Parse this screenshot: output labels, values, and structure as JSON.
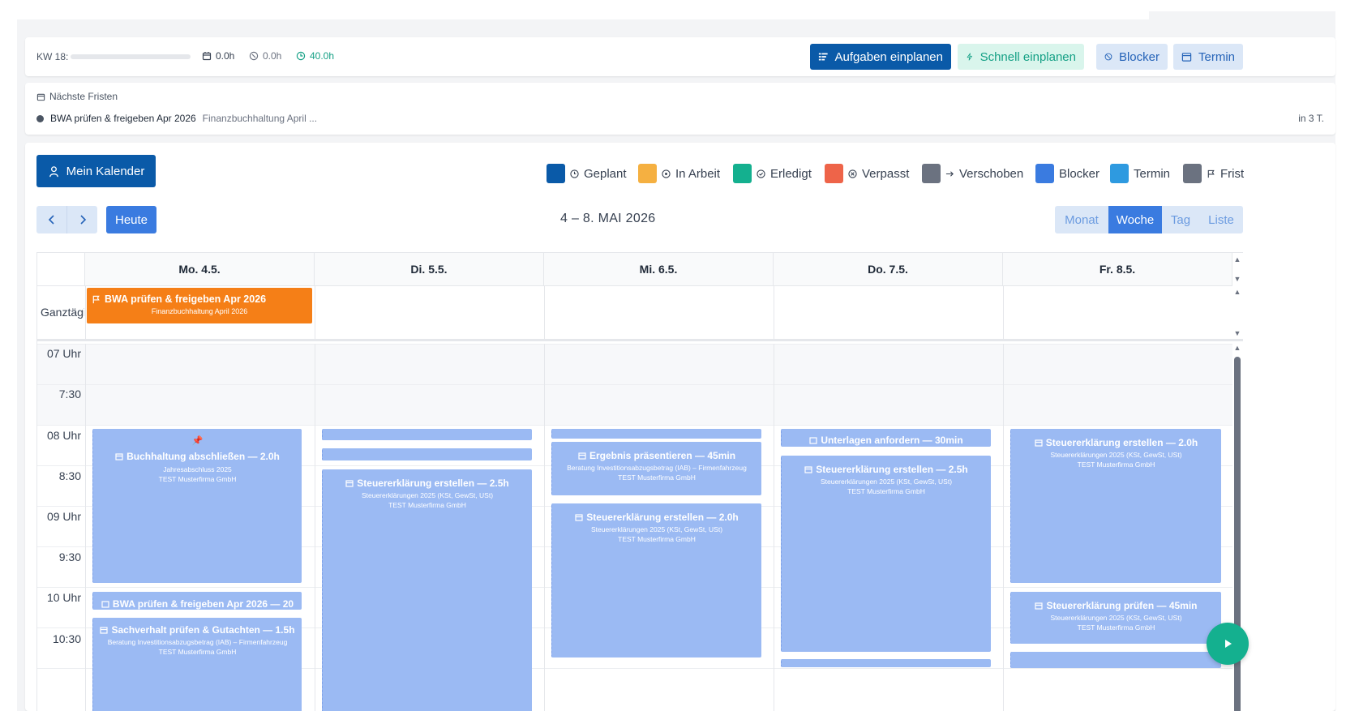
{
  "stats_bar": {
    "week_label": "KW 18:",
    "planned_hours": "0.0h",
    "in_progress_hours": "0.0h",
    "capacity_hours": "40.0h",
    "colors": {
      "capacity": "#14a085"
    }
  },
  "actions": {
    "plan_tasks": "Aufgaben einplanen",
    "quick_plan": "Schnell einplanen",
    "blocker": "Blocker",
    "appointment": "Termin"
  },
  "deadlines": {
    "title": "Nächste Fristen",
    "items": [
      {
        "title": "BWA prüfen & freigeben Apr 2026",
        "subtitle": "Finanzbuchhaltung April ...",
        "due": "in 3 T."
      }
    ]
  },
  "calendar": {
    "my_calendar_label": "Mein Kalender",
    "legend": [
      {
        "label": "Geplant",
        "color": "#0a5aa8",
        "icon": "clock-icon"
      },
      {
        "label": "In Arbeit",
        "color": "#f5b041",
        "icon": "play-circle-icon"
      },
      {
        "label": "Erledigt",
        "color": "#14b08f",
        "icon": "check-circle-icon"
      },
      {
        "label": "Verpasst",
        "color": "#ee6449",
        "icon": "x-circle-icon"
      },
      {
        "label": "Verschoben",
        "color": "#6b7280",
        "icon": "arrow-right-icon"
      },
      {
        "label": "Blocker",
        "color": "#3a7be0",
        "icon": ""
      },
      {
        "label": "Termin",
        "color": "#2e9ae0",
        "icon": ""
      },
      {
        "label": "Frist",
        "color": "#6b7280",
        "icon": "flag-icon"
      }
    ],
    "today_label": "Heute",
    "date_range": "4 – 8. MAI 2026",
    "views": [
      "Monat",
      "Woche",
      "Tag",
      "Liste"
    ],
    "active_view": "Woche",
    "days": [
      "Mo. 4.5.",
      "Di. 5.5.",
      "Mi. 6.5.",
      "Do. 7.5.",
      "Fr. 8.5."
    ],
    "all_day_label": "Ganztägig",
    "all_day_event": {
      "title": "BWA prüfen & freigeben Apr 2026",
      "subtitle": "Finanzbuchhaltung April 2026",
      "color": "#f57f17"
    },
    "time_labels": [
      "07 Uhr",
      "7:30",
      "08 Uhr",
      "8:30",
      "09 Uhr",
      "9:30",
      "10 Uhr",
      "10:30"
    ],
    "events": {
      "mon_1": {
        "title": "Buchhaltung abschließen — 2.0h",
        "line1": "Jahresabschluss 2025",
        "line2": "TEST Musterfirma GmbH"
      },
      "mon_2": {
        "title": "BWA prüfen & freigeben Apr 2026 — 20"
      },
      "mon_3": {
        "title": "Sachverhalt prüfen & Gutachten — 1.5h",
        "line1": "Beratung Investitionsabzugsbetrag (IAB) – Firmenfahrzeug",
        "line2": "TEST Musterfirma GmbH"
      },
      "tue_1": {
        "title": "Steuererklärung erstellen — 2.5h",
        "line1": "Steuererklärungen 2025 (KSt, GewSt, USt)",
        "line2": "TEST Musterfirma GmbH"
      },
      "wed_1": {
        "title": "Ergebnis präsentieren — 45min",
        "line1": "Beratung Investitionsabzugsbetrag (IAB) – Firmenfahrzeug",
        "line2": "TEST Musterfirma GmbH"
      },
      "wed_2": {
        "title": "Steuererklärung erstellen — 2.0h",
        "line1": "Steuererklärungen 2025 (KSt, GewSt, USt)",
        "line2": "TEST Musterfirma GmbH"
      },
      "thu_1": {
        "title": "Unterlagen anfordern — 30min"
      },
      "thu_2": {
        "title": "Steuererklärung erstellen — 2.5h",
        "line1": "Steuererklärungen 2025 (KSt, GewSt, USt)",
        "line2": "TEST Musterfirma GmbH"
      },
      "fri_1": {
        "title": "Steuererklärung erstellen — 2.0h",
        "line1": "Steuererklärungen 2025 (KSt, GewSt, USt)",
        "line2": "TEST Musterfirma GmbH"
      },
      "fri_2": {
        "title": "Steuererklärung prüfen — 45min",
        "line1": "Steuererklärungen 2025 (KSt, GewSt, USt)",
        "line2": "TEST Musterfirma GmbH"
      }
    }
  }
}
